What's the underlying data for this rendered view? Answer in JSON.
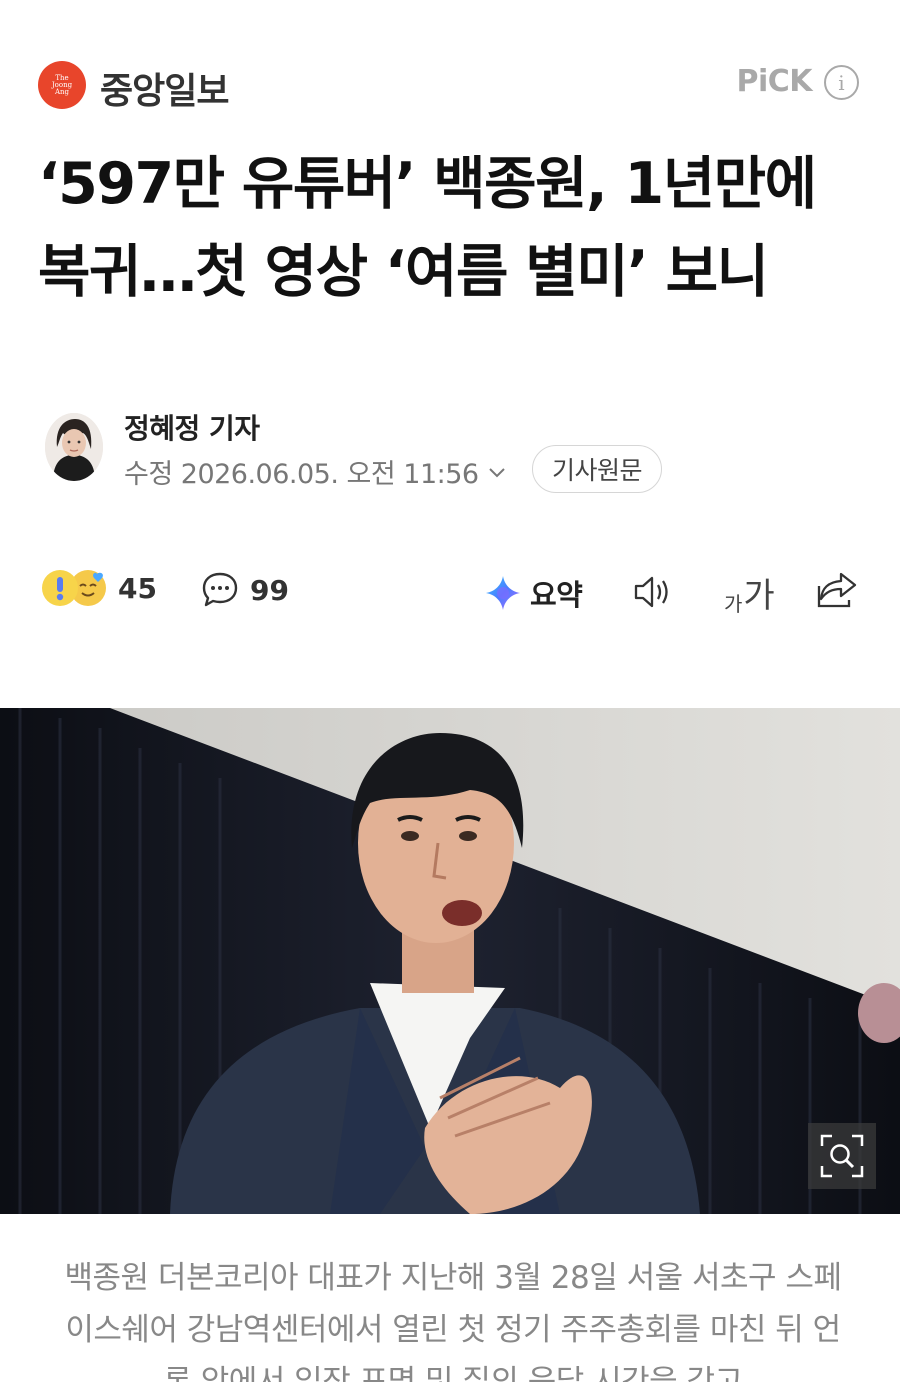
{
  "press": {
    "name": "중앙일보",
    "logo_text": [
      "The",
      "Joong",
      "Ang"
    ]
  },
  "pick": {
    "label": "PiCK",
    "info_icon": "i"
  },
  "headline": "‘597만 유튜버’ 백종원, 1년만에 복귀…첫 영상 ‘여름 별미’ 보니",
  "author": {
    "name": "정혜정 기자",
    "date": "수정 2026.06.05. 오전 11:56",
    "original_button": "기사원문"
  },
  "actions": {
    "reaction_count": "45",
    "comment_count": "99",
    "summary_label": "요약",
    "font_small": "가",
    "font_big": "가"
  },
  "caption": "백종원 더본코리아 대표가 지난해 3월 28일 서울 서초구 스페이스쉐어 강남역센터에서 열린 첫 정기 주주총회를 마친 뒤 언론 앞에서 입장 표명 및 질의 응답 시간을 갖고",
  "colors": {
    "brand_logo": "#e8452b",
    "pick_gray": "#a9a9a9",
    "caption_gray": "#888888",
    "summary_gradient": [
      "#4b7bff",
      "#b36cff",
      "#36c7ff"
    ]
  },
  "icons": {
    "reaction": "emoji-reaction-icon",
    "comment": "speech-bubble-icon",
    "summary": "ai-sparkle-icon",
    "tts": "speaker-icon",
    "font_size": "font-size-icon",
    "share": "share-icon",
    "zoom": "magnifier-zoom-icon",
    "date_toggle": "chevron-down-icon"
  }
}
